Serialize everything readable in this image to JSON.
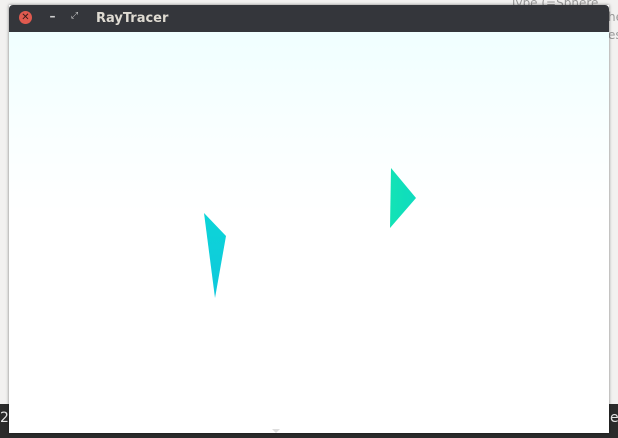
{
  "window": {
    "title": "RayTracer",
    "close_icon_glyph": "✕",
    "minimize_icon_glyph": "–",
    "maximize_icon_glyph": "⤢"
  },
  "background": {
    "partial_text_1": "Type (=Sphere",
    "partial_text_2": "he",
    "partial_text_3": "es",
    "bottom_left_text": "2",
    "bottom_right_text": "e"
  },
  "scene": {
    "objects": [
      {
        "name": "cyan-shard",
        "color_top": "#0cd5d8",
        "color_bottom": "#10c8dc"
      },
      {
        "name": "green-shard",
        "color_top": "#12e3b5",
        "color_bottom": "#0fdbbf"
      }
    ]
  },
  "colors": {
    "titlebar": "#34363b",
    "close_button": "#e05a4f",
    "canvas_sky_top": "#f0ffff"
  }
}
